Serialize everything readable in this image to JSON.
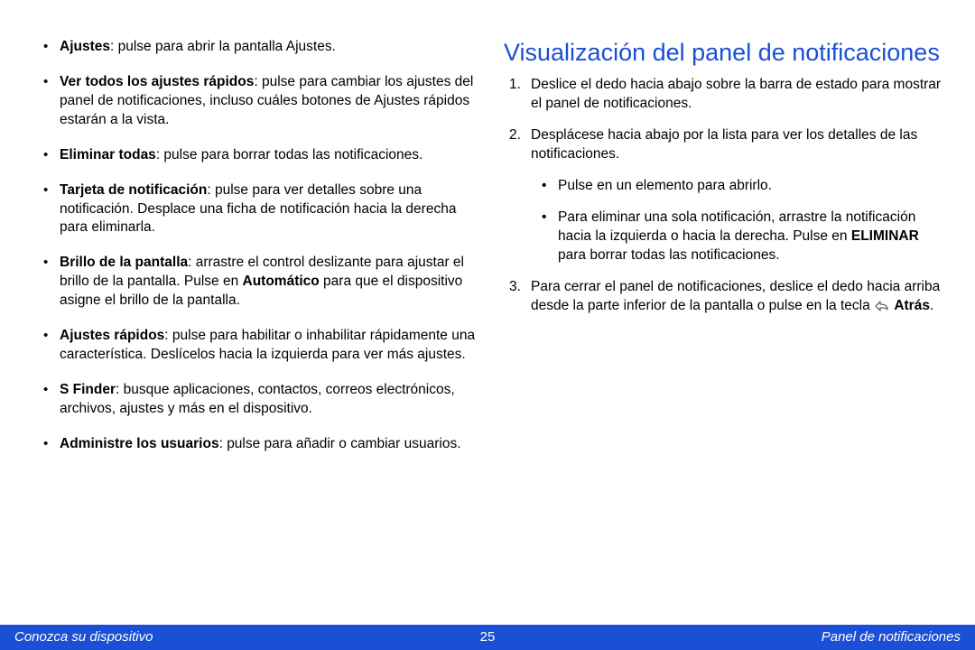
{
  "left": {
    "items": [
      {
        "term": "Ajustes",
        "desc": ": pulse para abrir la pantalla Ajustes."
      },
      {
        "term": "Ver todos los ajustes rápidos",
        "desc": ": pulse para cambiar los ajustes del panel de notificaciones, incluso cuáles botones de Ajustes rápidos estarán a la vista."
      },
      {
        "term": "Eliminar todas",
        "desc": ": pulse para borrar todas las notificaciones."
      },
      {
        "term": "Tarjeta de notificación",
        "desc": ": pulse para ver detalles sobre una notificación. Desplace una ficha de notificación hacia la derecha para eliminarla."
      },
      {
        "term": "Brillo de la pantalla",
        "desc_pre": ": arrastre el control deslizante para ajustar el brillo de la pantalla. Pulse en ",
        "desc_bold": "Automático",
        "desc_post": " para que el dispositivo asigne el brillo de la pantalla."
      },
      {
        "term": "Ajustes rápidos",
        "desc": ": pulse para habilitar o inhabilitar rápidamente una característica. Deslícelos hacia la izquierda para ver más ajustes."
      },
      {
        "term": "S Finder",
        "desc": ": busque aplicaciones, contactos, correos electrónicos, archivos, ajustes y más en el dispositivo."
      },
      {
        "term": "Administre los usuarios",
        "desc": ": pulse para añadir o cambiar usuarios."
      }
    ]
  },
  "right": {
    "heading": "Visualización del panel de notificaciones",
    "steps": {
      "s1": "Deslice el dedo hacia abajo sobre la barra de estado para mostrar el panel de notificaciones.",
      "s2": "Desplácese hacia abajo por la lista para ver los detalles de las notificaciones.",
      "s2_sub": {
        "a": "Pulse en un elemento para abrirlo.",
        "b_pre": "Para eliminar una sola notificación, arrastre la notificación hacia la izquierda o hacia la derecha. Pulse en ",
        "b_bold": "ELIMINAR",
        "b_post": " para borrar todas las notificaciones."
      },
      "s3_pre": "Para cerrar el panel de notificaciones, deslice el dedo hacia arriba desde la parte inferior de la pantalla o pulse en la tecla ",
      "s3_bold": "Atrás",
      "s3_post": "."
    }
  },
  "footer": {
    "left": "Conozca su dispositivo",
    "page": "25",
    "right": "Panel de notificaciones"
  }
}
